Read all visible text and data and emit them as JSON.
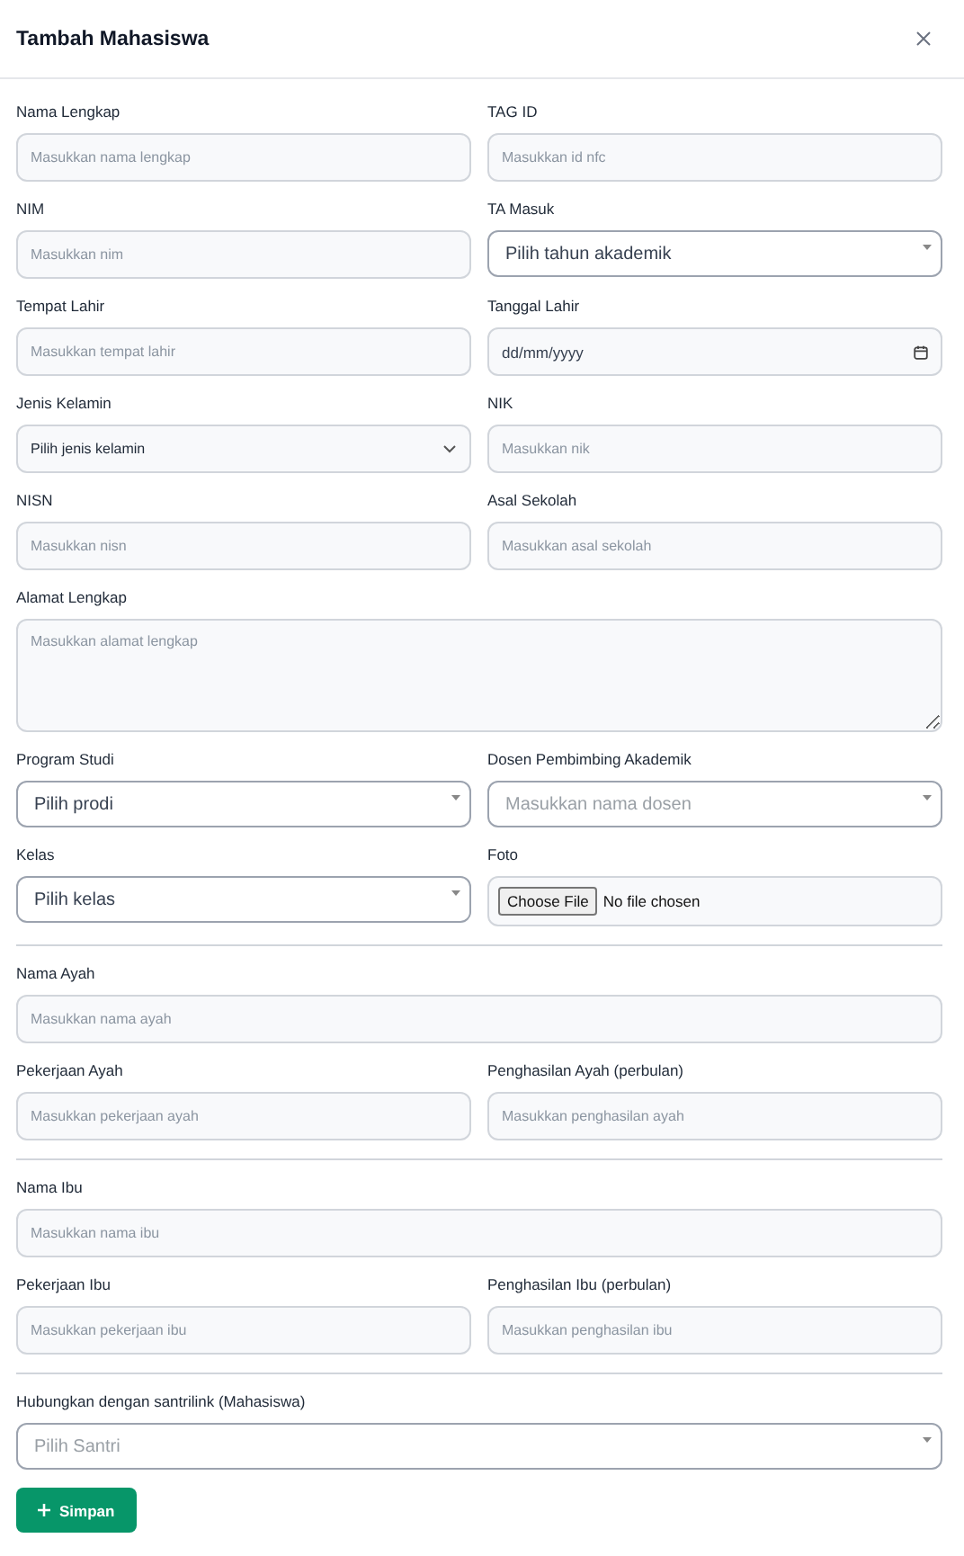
{
  "dialog": {
    "title": "Tambah Mahasiswa"
  },
  "sections": [
    {
      "rows": [
        [
          {
            "label": "Nama Lengkap",
            "kind": "text",
            "placeholder": "Masukkan nama lengkap"
          },
          {
            "label": "TAG ID",
            "kind": "text",
            "placeholder": "Masukkan id nfc"
          }
        ],
        [
          {
            "label": "NIM",
            "kind": "text",
            "placeholder": "Masukkan nim"
          },
          {
            "label": "TA Masuk",
            "kind": "select",
            "value": "Pilih tahun akademik"
          }
        ],
        [
          {
            "label": "Tempat Lahir",
            "kind": "text",
            "placeholder": "Masukkan tempat lahir"
          },
          {
            "label": "Tanggal Lahir",
            "kind": "date",
            "placeholder": "dd/mm/yyyy"
          }
        ],
        [
          {
            "label": "Jenis Kelamin",
            "kind": "native-select",
            "value": "Pilih jenis kelamin"
          },
          {
            "label": "NIK",
            "kind": "text",
            "placeholder": "Masukkan nik"
          }
        ],
        [
          {
            "label": "NISN",
            "kind": "text",
            "placeholder": "Masukkan nisn"
          },
          {
            "label": "Asal Sekolah",
            "kind": "text",
            "placeholder": "Masukkan asal sekolah"
          }
        ],
        [
          {
            "label": "Alamat Lengkap",
            "kind": "textarea",
            "placeholder": "Masukkan alamat lengkap"
          }
        ],
        [
          {
            "label": "Program Studi",
            "kind": "select",
            "value": "Pilih prodi"
          },
          {
            "label": "Dosen Pembimbing Akademik",
            "kind": "select",
            "placeholder": "Masukkan nama dosen"
          }
        ],
        [
          {
            "label": "Kelas",
            "kind": "select",
            "value": "Pilih kelas"
          },
          {
            "label": "Foto",
            "kind": "file",
            "button": "Choose File",
            "status": "No file chosen"
          }
        ]
      ]
    },
    {
      "rows": [
        [
          {
            "label": "Nama Ayah",
            "kind": "text",
            "placeholder": "Masukkan nama ayah"
          }
        ],
        [
          {
            "label": "Pekerjaan Ayah",
            "kind": "text",
            "placeholder": "Masukkan pekerjaan ayah"
          },
          {
            "label": "Penghasilan Ayah (perbulan)",
            "kind": "text",
            "placeholder": "Masukkan penghasilan ayah"
          }
        ]
      ]
    },
    {
      "rows": [
        [
          {
            "label": "Nama Ibu",
            "kind": "text",
            "placeholder": "Masukkan nama ibu"
          }
        ],
        [
          {
            "label": "Pekerjaan Ibu",
            "kind": "text",
            "placeholder": "Masukkan pekerjaan ibu"
          },
          {
            "label": "Penghasilan Ibu (perbulan)",
            "kind": "text",
            "placeholder": "Masukkan penghasilan ibu"
          }
        ]
      ]
    },
    {
      "rows": [
        [
          {
            "label": "Hubungkan dengan santrilink (Mahasiswa)",
            "kind": "select",
            "placeholder": "Pilih Santri"
          }
        ]
      ]
    }
  ],
  "submit_button": {
    "label": "Simpan"
  }
}
